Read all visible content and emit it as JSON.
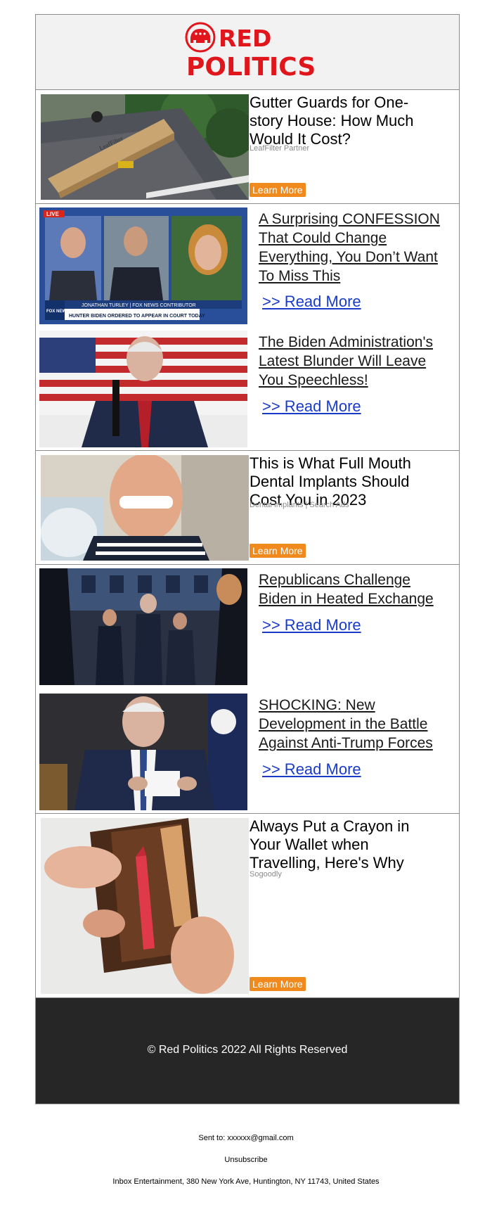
{
  "brand": {
    "name_line1": "RED",
    "name_line2": "POLITICS",
    "color": "#e0161c"
  },
  "ads": [
    {
      "title": "Gutter Guards for One-story House: How Much Would It Cost?",
      "source": "LeafFilter Partner",
      "button": "Learn More",
      "image_icon": "roof-gutter-box-photo"
    },
    {
      "title": "This is What Full Mouth Dental Implants Should Cost You in 2023",
      "source": "Dental Implants | Search Ads",
      "button": "Learn More",
      "image_icon": "smiling-man-dental-chair-photo"
    },
    {
      "title": "Always Put a Crayon in Your Wallet when Travelling, Here's Why",
      "source": "Sogoodly",
      "button": "Learn More",
      "image_icon": "wallet-crayon-photo"
    }
  ],
  "stories": [
    {
      "title": "A Surprising CONFESSION That Could Change Everything, You Don’t Want To Miss This",
      "read_more": ">> Read More",
      "image_icon": "news-broadcast-photo",
      "tv": {
        "live": "LIVE",
        "network": "FOX NEWS",
        "name": "JONATHAN TURLEY | FOX NEWS CONTRIBUTOR",
        "headline": "HUNTER BIDEN ORDERED TO APPEAR IN COURT TODAY"
      }
    },
    {
      "title": "The Biden Administration's Latest Blunder Will Leave You Speechless!",
      "read_more": ">> Read More",
      "image_icon": "speaker-flag-photo"
    },
    {
      "title": "Republicans Challenge Biden in Heated Exchange",
      "read_more": ">> Read More",
      "image_icon": "chamber-crowd-photo"
    },
    {
      "title": "SHOCKING: New Development in the Battle Against Anti-Trump Forces",
      "read_more": ">> Read More",
      "image_icon": "man-reading-card-photo"
    }
  ],
  "footer": {
    "copyright": "© Red Politics 2022 All Rights Reserved",
    "sent_to_label": "Sent to:",
    "sent_to_email": "xxxxxx@gmail.com",
    "unsubscribe": "Unsubscribe",
    "address": "Inbox Entertainment, 380 New York Ave, Huntington, NY 11743, United States"
  },
  "colors": {
    "accent": "#e0161c",
    "button": "#f08a1c",
    "link": "#1a3bc8",
    "footer_bg": "#262626"
  }
}
